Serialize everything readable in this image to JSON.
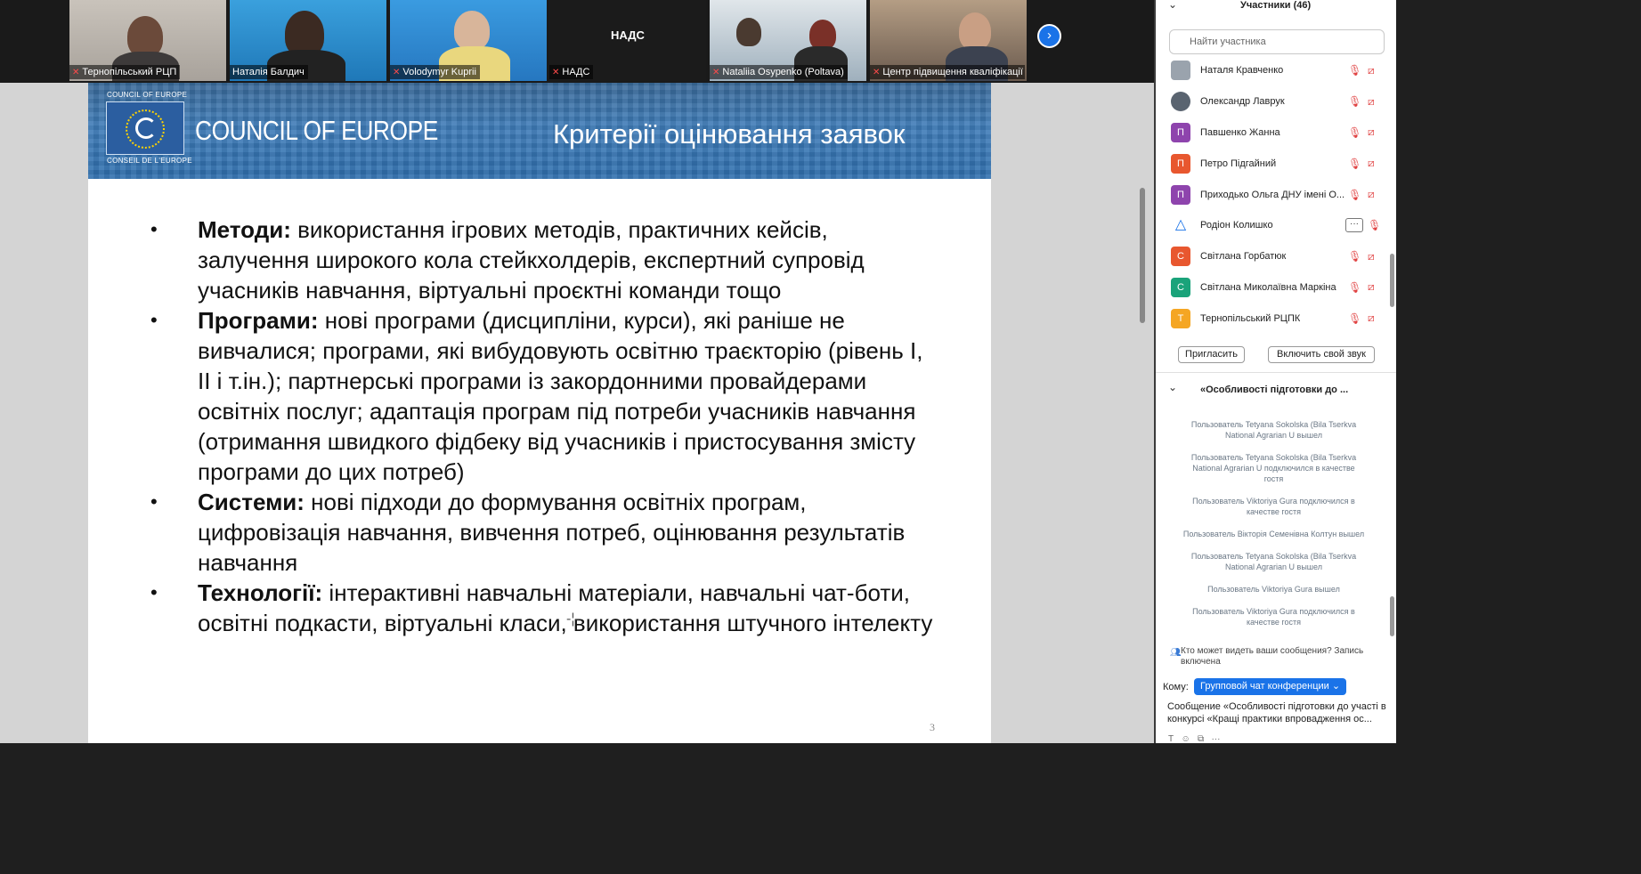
{
  "videos": [
    {
      "name": "Тернопільський РЦП"
    },
    {
      "name": "Наталія Балдич"
    },
    {
      "name": "Volodymyr Kupriі"
    },
    {
      "name": "НАДС",
      "center_label": "НАДС"
    },
    {
      "name": "Nataliia Osypenko (Poltava)"
    },
    {
      "name": "Центр підвищення кваліфікації"
    }
  ],
  "slide": {
    "org_small_top": "COUNCIL OF EUROPE",
    "org_small_bottom": "CONSEIL DE L'EUROPE",
    "org_title": "COUNCIL OF EUROPE",
    "title": "Критерії оцінювання заявок",
    "bullets": [
      {
        "term": "Методи:",
        "text": " використання ігрових методів, практичних кейсів, залучення широкого кола стейкхолдерів, експертний супровід учасників навчання, віртуальні проєктні команди тощо"
      },
      {
        "term": "Програми:",
        "text": " нові програми (дисципліни, курси), які раніше не вивчалися; програми, які вибудовують освітню траєкторію (рівень І, ІІ і т.ін.); партнерські програми із закордонними провайдерами освітніх послуг; адаптація програм під потреби учасників навчання (отримання швидкого фідбеку від учасників і пристосування змісту програми до цих потреб)"
      },
      {
        "term": "Системи:",
        "text": " нові підходи до формування освітніх програм, цифровізація навчання, вивчення потреб, оцінювання результатів навчання"
      },
      {
        "term": "Технології:",
        "text": " інтерактивні навчальні матеріали, навчальні чат-боти, освітні подкасти, віртуальні класи, використання штучного інтелекту"
      }
    ],
    "page_number": "3"
  },
  "participants": {
    "title": "Участники (46)",
    "search_placeholder": "Найти участника",
    "list": [
      {
        "name": "Наталя Кравченко",
        "initial": "",
        "color": "#9aa3ad"
      },
      {
        "name": "Олександр Лаврук",
        "initial": "",
        "color": "#5a6470"
      },
      {
        "name": "Павшенко Жанна",
        "initial": "П",
        "color": "#8e44ad"
      },
      {
        "name": "Петро Підгайний",
        "initial": "П",
        "color": "#e8572f"
      },
      {
        "name": "Приходько Ольга ДНУ імені О...",
        "initial": "П",
        "color": "#8e44ad"
      },
      {
        "name": "Родіон Колишко",
        "initial": "",
        "color": "#ffffff"
      },
      {
        "name": "Світлана Горбатюк",
        "initial": "С",
        "color": "#e8572f"
      },
      {
        "name": "Світлана Миколаївна Маркіна",
        "initial": "С",
        "color": "#1aa37a"
      },
      {
        "name": "Тернопільський РЦПК",
        "initial": "Т",
        "color": "#f5a623"
      }
    ],
    "invite_label": "Пригласить",
    "unmute_label": "Включить свой звук"
  },
  "chat": {
    "title": "«Особливості підготовки до ...",
    "messages": [
      "Пользователь Tetyana Sokolska (Bila Tserkva National Agrarian U вышел",
      "Пользователь Tetyana Sokolska (Bila Tserkva National Agrarian U подключился в качестве гостя",
      "Пользователь Viktoriya Gura подключился в качестве гостя",
      "Пользователь Вікторія Семенівна Колтун вышел",
      "Пользователь Tetyana Sokolska (Bila Tserkva National Agrarian U вышел",
      "Пользователь Viktoriya Gura вышел",
      "Пользователь Viktoriya Gura подключился в качестве гостя"
    ],
    "visibility_note": "Кто может видеть ваши сообщения? Запись включена",
    "to_label": "Кому:",
    "recipient": "Групповой чат конференции ⌄",
    "draft": "Сообщение «Особливості підготовки до участі в конкурсі «Кращі практики впровадження ос..."
  },
  "colors": {
    "accent": "#1a73e8",
    "mute": "#e04040",
    "banner": "#3f7cb8"
  }
}
